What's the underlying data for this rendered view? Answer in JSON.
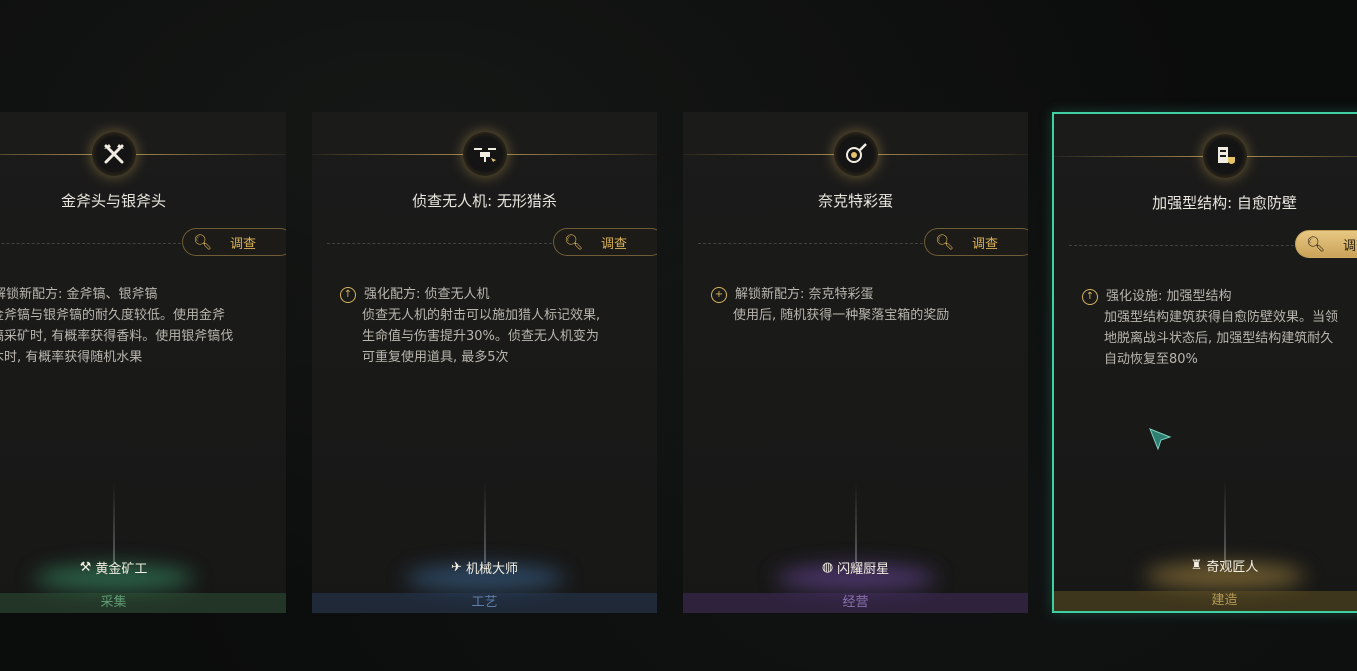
{
  "cards": [
    {
      "title": "金斧头与银斧头",
      "investigate": "调查",
      "effect_head": "解锁新配方: 金斧镐、银斧镐",
      "effect_body": "金斧镐与银斧镐的耐久度较低。使用金斧\n镐采矿时, 有概率获得香料。使用银斧镐伐\n木时, 有概率获得随机水果",
      "profession": "黄金矿工",
      "category": "采集",
      "icon": "crossed-axes-icon",
      "accent": "#3fb07a"
    },
    {
      "title": "侦查无人机: 无形猎杀",
      "investigate": "调查",
      "effect_head": "强化配方: 侦查无人机",
      "effect_body": "侦查无人机的射击可以施加猎人标记效果,\n生命值与伤害提升30%。侦查无人机变为\n可重复使用道具, 最多5次",
      "profession": "机械大师",
      "category": "工艺",
      "icon": "drone-icon",
      "accent": "#4a86c6"
    },
    {
      "title": "奈克特彩蛋",
      "investigate": "调查",
      "effect_head": "解锁新配方: 奈克特彩蛋",
      "effect_body": "使用后, 随机获得一种聚落宝箱的奖励",
      "profession": "闪耀厨星",
      "category": "经营",
      "icon": "frying-pan-icon",
      "accent": "#8a5ad0"
    },
    {
      "title": "加强型结构: 自愈防壁",
      "investigate": "调查",
      "effect_head": "强化设施: 加强型结构",
      "effect_body": "加强型结构建筑获得自愈防壁效果。当领\n地脱离战斗状态后, 加强型结构建筑耐久\n自动恢复至80%",
      "profession": "奇观匠人",
      "category": "建造",
      "icon": "building-shield-icon",
      "accent": "#c9a44a"
    }
  ]
}
